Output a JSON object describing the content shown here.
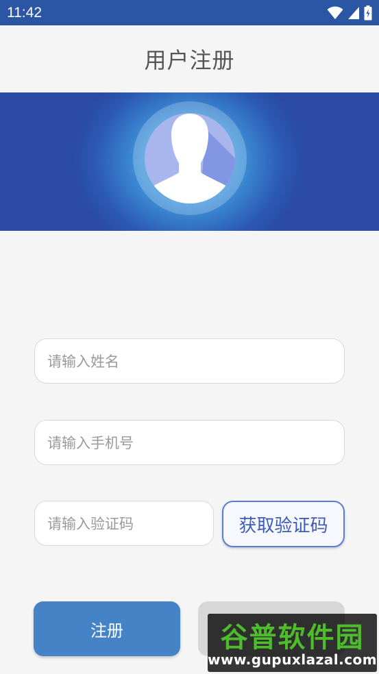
{
  "status_bar": {
    "time": "11:42"
  },
  "header": {
    "title": "用户注册"
  },
  "form": {
    "name_placeholder": "请输入姓名",
    "phone_placeholder": "请输入手机号",
    "code_placeholder": "请输入验证码",
    "get_code_label": "获取验证码"
  },
  "buttons": {
    "register_label": "注册"
  },
  "watermark": {
    "title": "谷普软件园",
    "url": "www.gupuxlazal.com"
  },
  "colors": {
    "status_bar": "#2b56a4",
    "banner_edge": "#2a4aa3",
    "banner_center": "#5dc0ea",
    "register_button": "#4583c6",
    "code_button_border": "#5b7bd4"
  }
}
